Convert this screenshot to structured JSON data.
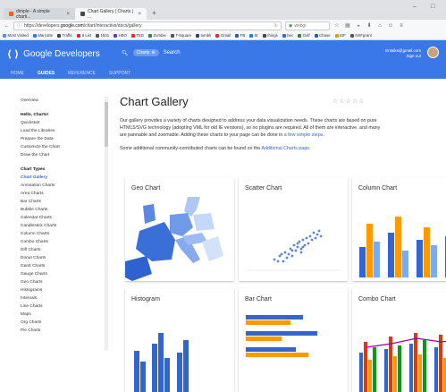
{
  "browser": {
    "tabs": [
      {
        "label": "dimple - A simple charti...",
        "close": "×",
        "favicon_color": "#e8632b"
      },
      {
        "label": "Chart Gallery | Charts | ...",
        "close": "×",
        "favicon_color": "#4a4a4a"
      }
    ],
    "new_tab": "+",
    "window_controls": {
      "minimize": "–",
      "maximize": "□"
    },
    "url_prefix": "https://developers.",
    "url_host": "google.com",
    "url_path": "/chart/interactive/docs/gallery",
    "search_engine": "webgi"
  },
  "bookmarks": [
    {
      "label": "Most Visited",
      "color": "#5b8def"
    },
    {
      "label": "Marcotte",
      "color": "#2a7ae2"
    },
    {
      "label": "Traffic",
      "color": "#444"
    },
    {
      "label": "8 List",
      "color": "#c33"
    },
    {
      "label": "1531",
      "color": "#555"
    },
    {
      "label": "HBO",
      "color": "#6a3fa0"
    },
    {
      "label": "TED",
      "color": "#e62b1e"
    },
    {
      "label": "Zombie",
      "color": "#2b8a3e"
    },
    {
      "label": "T-Square",
      "color": "#555"
    },
    {
      "label": "tumblr",
      "color": "#36465d"
    },
    {
      "label": "Gmail",
      "color": "#d93025"
    },
    {
      "label": "FB",
      "color": "#3b5998"
    },
    {
      "label": "IE",
      "color": "#1e7fd6"
    },
    {
      "label": "things",
      "color": "#444"
    },
    {
      "label": "bec",
      "color": "#3367d6"
    },
    {
      "label": "Golf",
      "color": "#2b8a3e"
    },
    {
      "label": "Chase",
      "color": "#1a5fb4"
    },
    {
      "label": "IDF",
      "color": "#e0a100"
    },
    {
      "label": "NSFgrant",
      "color": "#555"
    }
  ],
  "header": {
    "logo": "Google Developers",
    "search_chip": "Charts",
    "search_label": "Search",
    "account_line1": "Entalks@gmail.com",
    "account_line2": "Sign out",
    "nav": [
      "HOME",
      "GUIDES",
      "REFERENCE",
      "SUPPORT"
    ]
  },
  "sidebar": {
    "items": [
      {
        "label": "Overview",
        "kind": "normal"
      },
      {
        "label": "",
        "kind": "gap"
      },
      {
        "label": "Hello, Charts!",
        "kind": "heading"
      },
      {
        "label": "Quickstart",
        "kind": "normal"
      },
      {
        "label": "Load the Libraries",
        "kind": "normal"
      },
      {
        "label": "Prepare the Data",
        "kind": "normal"
      },
      {
        "label": "Customize the Chart",
        "kind": "normal"
      },
      {
        "label": "Draw the Chart",
        "kind": "normal"
      },
      {
        "label": "",
        "kind": "gap"
      },
      {
        "label": "Chart Types",
        "kind": "heading"
      },
      {
        "label": "Chart Gallery",
        "kind": "active"
      },
      {
        "label": "Annotation Charts",
        "kind": "normal"
      },
      {
        "label": "Area Charts",
        "kind": "normal"
      },
      {
        "label": "Bar Charts",
        "kind": "normal"
      },
      {
        "label": "Bubble Charts",
        "kind": "normal"
      },
      {
        "label": "Calendar Charts",
        "kind": "normal"
      },
      {
        "label": "Candlestick Charts",
        "kind": "normal"
      },
      {
        "label": "Column Charts",
        "kind": "normal"
      },
      {
        "label": "Combo Charts",
        "kind": "normal"
      },
      {
        "label": "Diff Charts",
        "kind": "normal"
      },
      {
        "label": "Donut Charts",
        "kind": "normal"
      },
      {
        "label": "Gantt Charts",
        "kind": "normal"
      },
      {
        "label": "Gauge Charts",
        "kind": "normal"
      },
      {
        "label": "Geo Charts",
        "kind": "normal"
      },
      {
        "label": "Histograms",
        "kind": "normal"
      },
      {
        "label": "Intervals",
        "kind": "normal"
      },
      {
        "label": "Line Charts",
        "kind": "normal"
      },
      {
        "label": "Maps",
        "kind": "normal"
      },
      {
        "label": "Org Charts",
        "kind": "normal"
      },
      {
        "label": "Pie Charts",
        "kind": "normal"
      }
    ]
  },
  "main": {
    "title": "Chart Gallery",
    "rating_stars": "☆☆☆☆☆",
    "intro": "Our gallery provides a variety of charts designed to address your data visualization needs. These charts are based on pure HTML5/SVG technology (adopting VML for old IE versions), so no plugins are required. All of them are interactive, and many are pannable and zoomable. Adding these charts to your page can be done in ",
    "intro_link": "a few simple steps",
    "intro_end": ".",
    "extra": "Some additional community-contributed charts can be found on the ",
    "extra_link": "Additional Charts page",
    "extra_end": ".",
    "cards": [
      {
        "title": "Geo Chart"
      },
      {
        "title": "Scatter Chart"
      },
      {
        "title": "Column Chart"
      },
      {
        "title": "Histogram"
      },
      {
        "title": "Bar Chart"
      },
      {
        "title": "Combo Chart"
      }
    ]
  },
  "colors": {
    "header_blue": "#3b78e7",
    "link_blue": "#3367d6",
    "chart_blue": "#3366cc",
    "chart_light_blue": "#7baaf7",
    "chart_orange": "#ff9900",
    "chart_green": "#109618"
  }
}
